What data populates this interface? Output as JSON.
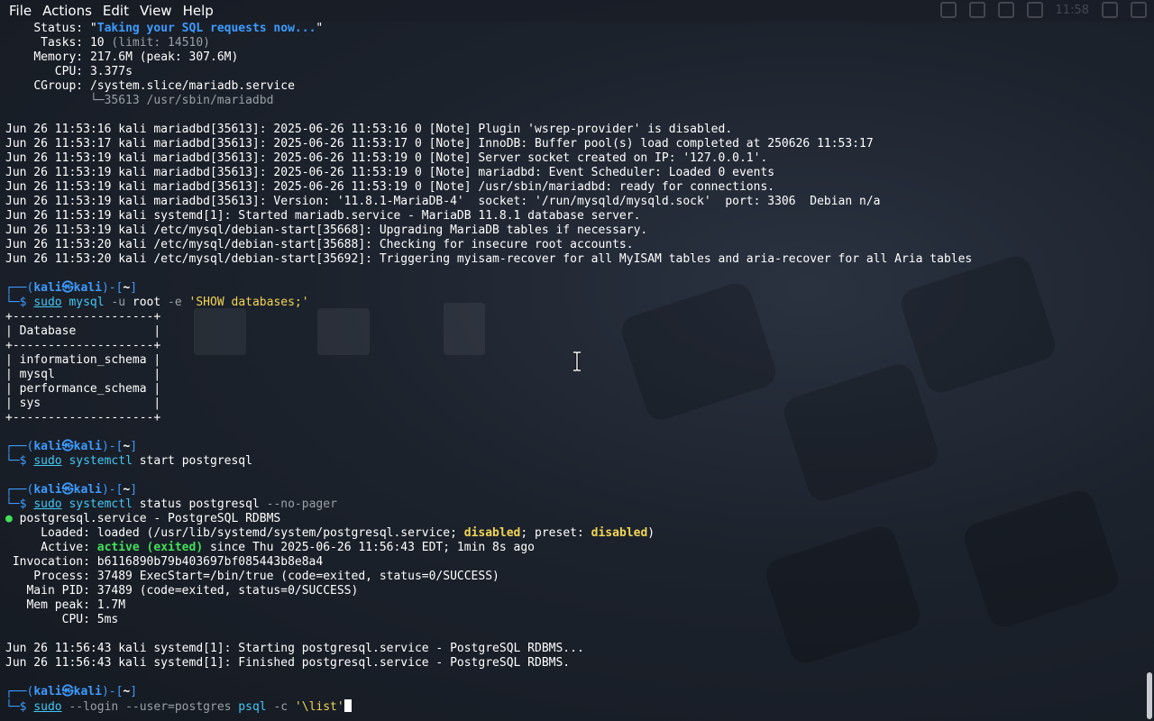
{
  "menubar": {
    "items": [
      "File",
      "Actions",
      "Edit",
      "View",
      "Help"
    ],
    "clock": "11:58"
  },
  "terminal": {
    "service_status_top": {
      "status_label": "Status:",
      "status_value": "Taking your SQL requests now...",
      "tasks_label": "Tasks:",
      "tasks_value": "10",
      "tasks_limit": "(limit: 14510)",
      "memory_label": "Memory:",
      "memory_value": "217.6M (peak: 307.6M)",
      "cpu_label": "CPU:",
      "cpu_value": "3.377s",
      "cgroup_label": "CGroup:",
      "cgroup_value": "/system.slice/mariadb.service",
      "cgroup_child": "└─35613 /usr/sbin/mariadbd"
    },
    "mariadb_log": [
      "Jun 26 11:53:16 kali mariadbd[35613]: 2025-06-26 11:53:16 0 [Note] Plugin 'wsrep-provider' is disabled.",
      "Jun 26 11:53:17 kali mariadbd[35613]: 2025-06-26 11:53:17 0 [Note] InnoDB: Buffer pool(s) load completed at 250626 11:53:17",
      "Jun 26 11:53:19 kali mariadbd[35613]: 2025-06-26 11:53:19 0 [Note] Server socket created on IP: '127.0.0.1'.",
      "Jun 26 11:53:19 kali mariadbd[35613]: 2025-06-26 11:53:19 0 [Note] mariadbd: Event Scheduler: Loaded 0 events",
      "Jun 26 11:53:19 kali mariadbd[35613]: 2025-06-26 11:53:19 0 [Note] /usr/sbin/mariadbd: ready for connections.",
      "Jun 26 11:53:19 kali mariadbd[35613]: Version: '11.8.1-MariaDB-4'  socket: '/run/mysqld/mysqld.sock'  port: 3306  Debian n/a",
      "Jun 26 11:53:19 kali systemd[1]: Started mariadb.service - MariaDB 11.8.1 database server.",
      "Jun 26 11:53:19 kali /etc/mysql/debian-start[35668]: Upgrading MariaDB tables if necessary.",
      "Jun 26 11:53:20 kali /etc/mysql/debian-start[35688]: Checking for insecure root accounts.",
      "Jun 26 11:53:20 kali /etc/mysql/debian-start[35692]: Triggering myisam-recover for all MyISAM tables and aria-recover for all Aria tables"
    ],
    "prompt": {
      "top": "┌──(",
      "user": "kali㉿kali",
      "mid": ")-[",
      "dir": "~",
      "end": "]",
      "bottom": "└─$ "
    },
    "cmd1": {
      "sudo": "sudo",
      "prog": "mysql",
      "opt1": "-u",
      "arg1": "root",
      "opt2": "-e",
      "str": "'SHOW databases;'"
    },
    "db_table": [
      "+--------------------+",
      "| Database           |",
      "+--------------------+",
      "| information_schema |",
      "| mysql              |",
      "| performance_schema |",
      "| sys                |",
      "+--------------------+"
    ],
    "cmd2": {
      "sudo": "sudo",
      "prog": "systemctl",
      "args": "start postgresql"
    },
    "cmd3": {
      "sudo": "sudo",
      "prog": "systemctl",
      "args": "status postgresql",
      "opt": "--no-pager"
    },
    "pg_status": {
      "dot": "●",
      "unit": "postgresql.service - PostgreSQL RDBMS",
      "loaded_label": "     Loaded:",
      "loaded_pre": " loaded (/usr/lib/systemd/system/postgresql.service; ",
      "loaded_disabled": "disabled",
      "loaded_mid": "; preset: ",
      "loaded_preset": "disabled",
      "loaded_post": ")",
      "active_label": "     Active:",
      "active_value": "active (exited)",
      "active_since": " since Thu 2025-06-26 11:56:43 EDT; 1min 8s ago",
      "invocation": " Invocation: b6116890b79b403697bf085443b8e8a4",
      "process": "    Process: 37489 ExecStart=/bin/true (code=exited, status=0/SUCCESS)",
      "mainpid": "   Main PID: 37489 (code=exited, status=0/SUCCESS)",
      "mempeak": "   Mem peak: 1.7M",
      "cpu": "        CPU: 5ms"
    },
    "pg_log": [
      "Jun 26 11:56:43 kali systemd[1]: Starting postgresql.service - PostgreSQL RDBMS...",
      "Jun 26 11:56:43 kali systemd[1]: Finished postgresql.service - PostgreSQL RDBMS."
    ],
    "cmd4": {
      "sudo": "sudo",
      "opt": "--login --user=postgres",
      "prog": "psql",
      "opt2": "-c",
      "str": "'\\list'"
    }
  },
  "colors": {
    "accent_blue": "#3d9bff",
    "command_cyan": "#42c7f5",
    "active_green": "#42e05a",
    "warning_yellow": "#f2d554"
  }
}
